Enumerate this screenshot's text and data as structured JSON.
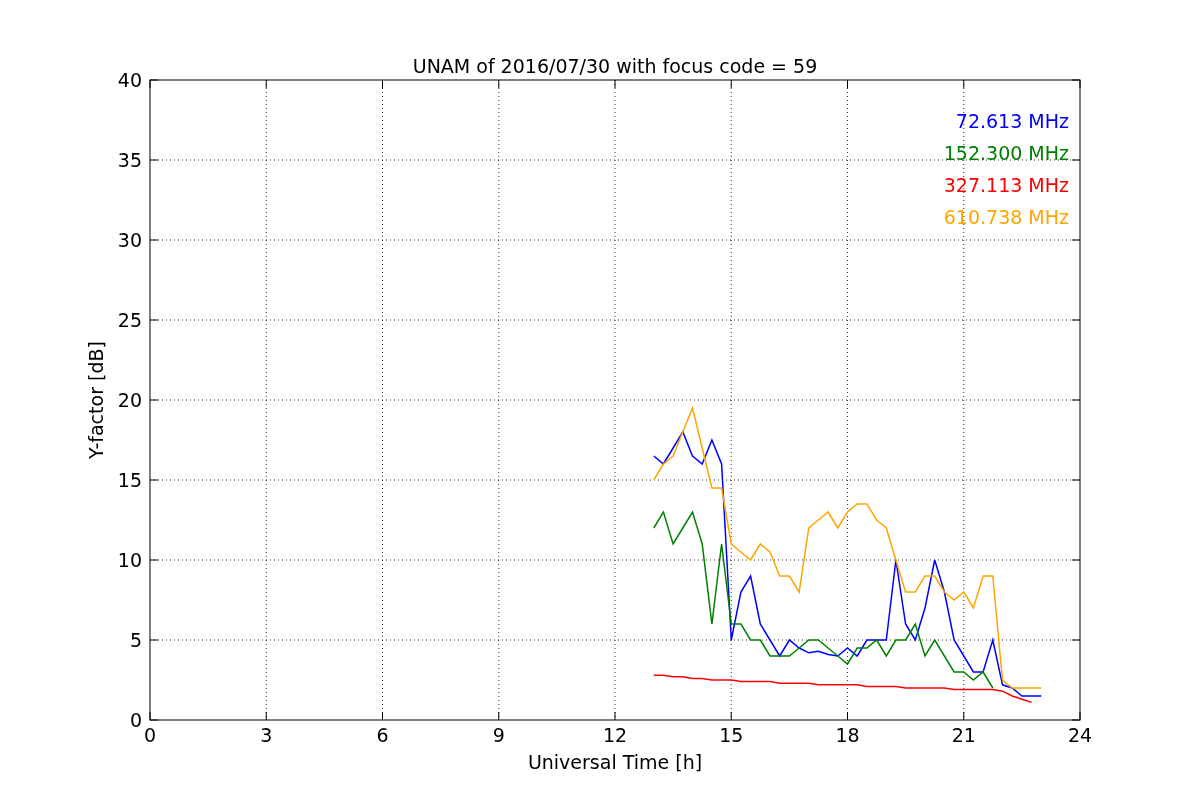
{
  "chart_data": {
    "type": "line",
    "title": "UNAM of 2016/07/30 with focus code = 59",
    "xlabel": "Universal Time [h]",
    "ylabel": "Y-factor [dB]",
    "x": [
      13,
      13.25,
      13.5,
      13.75,
      14,
      14.25,
      14.5,
      14.75,
      15,
      15.25,
      15.5,
      15.75,
      16,
      16.25,
      16.5,
      16.75,
      17,
      17.25,
      17.5,
      17.75,
      18,
      18.25,
      18.5,
      18.75,
      19,
      19.25,
      19.5,
      19.75,
      20,
      20.25,
      20.5,
      20.75,
      21,
      21.25,
      21.5,
      21.75,
      22,
      22.25,
      22.5,
      22.75,
      23
    ],
    "series": [
      {
        "name": "72.613 MHz",
        "color": "#0000ff",
        "values": [
          16.5,
          16,
          17,
          18,
          16.5,
          16,
          17.5,
          16,
          5,
          8,
          9,
          6,
          5,
          4,
          5,
          4.5,
          4.2,
          4.3,
          4.1,
          4,
          4.5,
          4,
          5,
          5,
          5,
          10,
          6,
          5,
          7,
          10,
          8,
          5,
          4,
          3,
          3,
          5,
          2.2,
          2,
          1.5,
          1.5,
          1.5
        ]
      },
      {
        "name": "152.300 MHz",
        "color": "#008000",
        "values": [
          12,
          13,
          11,
          12,
          13,
          11,
          6,
          11,
          6,
          6,
          5,
          5,
          4,
          4,
          4,
          4.5,
          5,
          5,
          4.5,
          4,
          3.5,
          4.5,
          4.5,
          5,
          4,
          5,
          5,
          6,
          4,
          5,
          4,
          3,
          3,
          2.5,
          3,
          2,
          null,
          null,
          null,
          null,
          null
        ]
      },
      {
        "name": "327.113 MHz",
        "color": "#ff0000",
        "values": [
          2.8,
          2.8,
          2.7,
          2.7,
          2.6,
          2.6,
          2.5,
          2.5,
          2.5,
          2.4,
          2.4,
          2.4,
          2.4,
          2.3,
          2.3,
          2.3,
          2.3,
          2.2,
          2.2,
          2.2,
          2.2,
          2.2,
          2.1,
          2.1,
          2.1,
          2.1,
          2,
          2,
          2,
          2,
          2,
          1.9,
          1.9,
          1.9,
          1.9,
          1.9,
          1.8,
          1.5,
          1.3,
          1.1,
          null
        ]
      },
      {
        "name": "610.738 MHz",
        "color": "#ffa500",
        "values": [
          15,
          16,
          16.5,
          18,
          19.5,
          17,
          14.5,
          14.5,
          11,
          10.5,
          10,
          11,
          10.5,
          9,
          9,
          8,
          12,
          12.5,
          13,
          12,
          13,
          13.5,
          13.5,
          12.5,
          12,
          10,
          8,
          8,
          9,
          9,
          8,
          7.5,
          8,
          7,
          9,
          9,
          2.5,
          2,
          2,
          2,
          2
        ]
      }
    ],
    "xlim": [
      0,
      24
    ],
    "ylim": [
      0,
      40
    ],
    "xticks": [
      0,
      3,
      6,
      9,
      12,
      15,
      18,
      21,
      24
    ],
    "yticks": [
      0,
      5,
      10,
      15,
      20,
      25,
      30,
      35,
      40
    ],
    "grid": true
  }
}
